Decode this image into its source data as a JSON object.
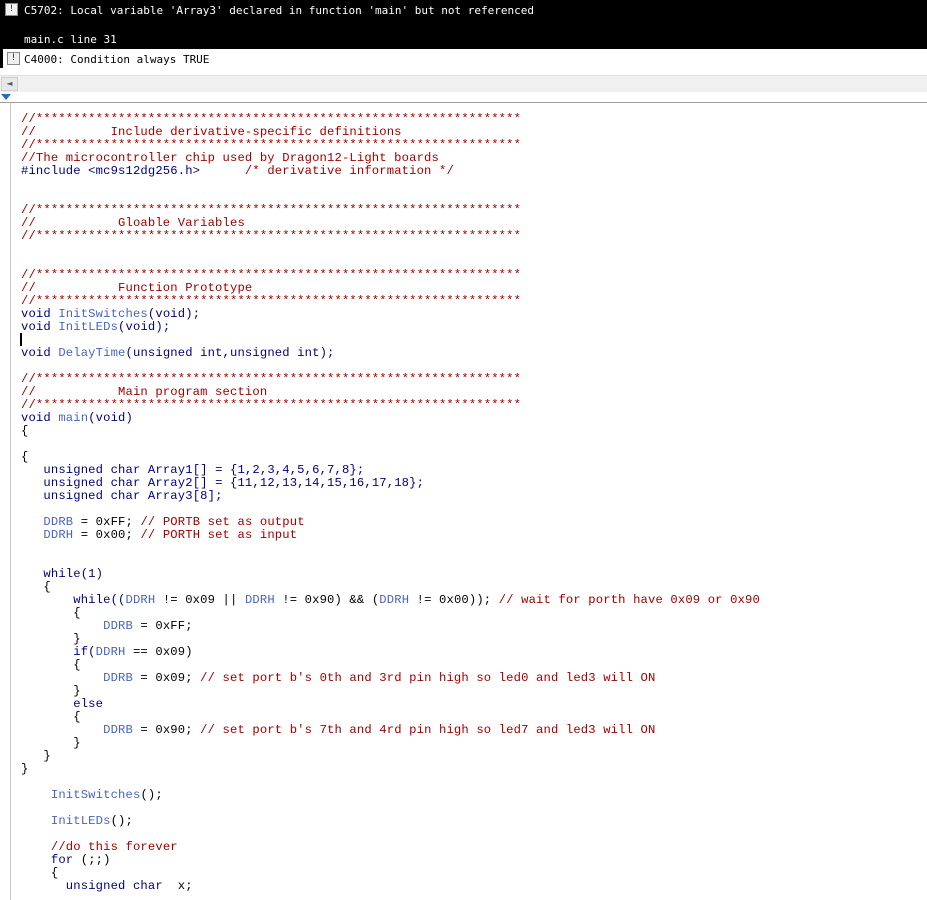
{
  "messages": [
    {
      "code_text": "C5702: Local variable 'Array3' declared in function 'main' but not referenced",
      "location": "main.c line 31",
      "icon": "warning-icon"
    },
    {
      "code_text": "C4000: Condition always TRUE",
      "icon": "warning-icon"
    }
  ],
  "scrollbar": {
    "left_arrow": "◄"
  },
  "colors": {
    "comment": "#a00000",
    "identifier": "#4a64c0",
    "keyword": "#000080",
    "message_bg": "#000000"
  },
  "code": {
    "l01": "//*****************************************************************",
    "l02": "//          Include derivative-specific definitions",
    "l03": "//*****************************************************************",
    "l04": "//The microcontroller chip used by Dragon12-Light boards",
    "l05a": "#include <mc9s12dg256.h>",
    "l05b": "      /* derivative information */",
    "l08": "//*****************************************************************",
    "l09": "//           Gloable Variables",
    "l10": "//*****************************************************************",
    "l13": "//*****************************************************************",
    "l14": "//           Function Prototype",
    "l15": "//*****************************************************************",
    "l16a": "void",
    "l16b": "InitSwitches",
    "l16c": "(void);",
    "l17a": "void",
    "l17b": "InitLEDs",
    "l17c": "(void);",
    "l19a": "void",
    "l19b": "DelayTime",
    "l19c": "(unsigned int,unsigned int);",
    "l21": "//*****************************************************************",
    "l22": "//           Main program section",
    "l23": "//*****************************************************************",
    "l24a": "void",
    "l24b": "main",
    "l24c": "(void)",
    "l25": "{",
    "l27": "{",
    "l28a": "   unsigned char",
    "l28b": "Array1",
    "l28c": "[] = {1,2,3,4,5,6,7,8};",
    "l29a": "   unsigned char",
    "l29b": "Array2",
    "l29c": "[] = {11,12,13,14,15,16,17,18};",
    "l30a": "   unsigned char",
    "l30b": "Array3",
    "l30c": "[8];",
    "l32a": "DDRB",
    "l32b": " = 0xFF; ",
    "l32c": "// PORTB set as output",
    "l33a": "DDRH",
    "l33b": " = 0x00; ",
    "l33c": "// PORTH set as input",
    "l36": "   while(1)",
    "l37": "   {",
    "l38a": "       while((",
    "l38b": "DDRH",
    "l38c": " != 0x09 || ",
    "l38d": "DDRH",
    "l38e": " != 0x90) && (",
    "l38f": "DDRH",
    "l38g": " != 0x00)); ",
    "l38h": "// wait for porth have 0x09 or 0x90",
    "l39": "       {",
    "l40a": "DDRB",
    "l40b": " = 0xFF;",
    "l41": "       }",
    "l42a": "       if(",
    "l42b": "DDRH",
    "l42c": " == 0x09)",
    "l43": "       {",
    "l44a": "DDRB",
    "l44b": " = 0x09; ",
    "l44c": "// set port b's 0th and 3rd pin high so led0 and led3 will ON",
    "l45": "       }",
    "l46": "       else",
    "l47": "       {",
    "l48a": "DDRB",
    "l48b": " = 0x90; ",
    "l48c": "// set port b's 7th and 4rd pin high so led7 and led3 will ON",
    "l49": "       }",
    "l50": "   }",
    "l51": "}",
    "l53a": "InitSwitches",
    "l53b": "();",
    "l55a": "InitLEDs",
    "l55b": "();",
    "l57": "//do this forever",
    "l58a": "for",
    "l58b": " (;;)",
    "l59": "{",
    "l60a": "unsigned char",
    "l60b": "  x;"
  }
}
